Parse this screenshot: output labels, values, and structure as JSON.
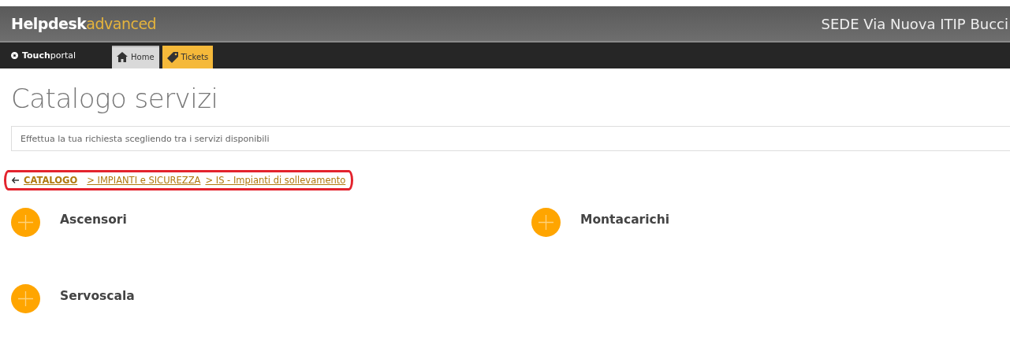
{
  "header": {
    "brand_bold": "Helpdesk",
    "brand_light": "advanced",
    "location": "SEDE Via Nuova ITIP Bucci"
  },
  "nav": {
    "portal_bold": "Touch",
    "portal_light": "portal",
    "tabs": [
      {
        "label": "Home",
        "kind": "home",
        "selected": true,
        "color": "#d9d9d9"
      },
      {
        "label": "Tickets",
        "kind": "tickets",
        "selected": false,
        "color": "#f5b93a"
      }
    ]
  },
  "page": {
    "title": "Catalogo servizi",
    "search": {
      "placeholder": "Effettua la tua richiesta scegliendo tra i servizi disponibili"
    }
  },
  "breadcrumb": {
    "highlighted": true,
    "items": [
      {
        "label": "CATALOGO",
        "kind": "root"
      },
      {
        "label": "> IMPIANTI e SICUREZZA",
        "kind": "level"
      },
      {
        "label": "> IS - Impianti di sollevamento",
        "kind": "level"
      }
    ]
  },
  "services": [
    {
      "label": "Ascensori"
    },
    {
      "label": "Montacarichi"
    },
    {
      "label": "Servoscala"
    }
  ]
}
